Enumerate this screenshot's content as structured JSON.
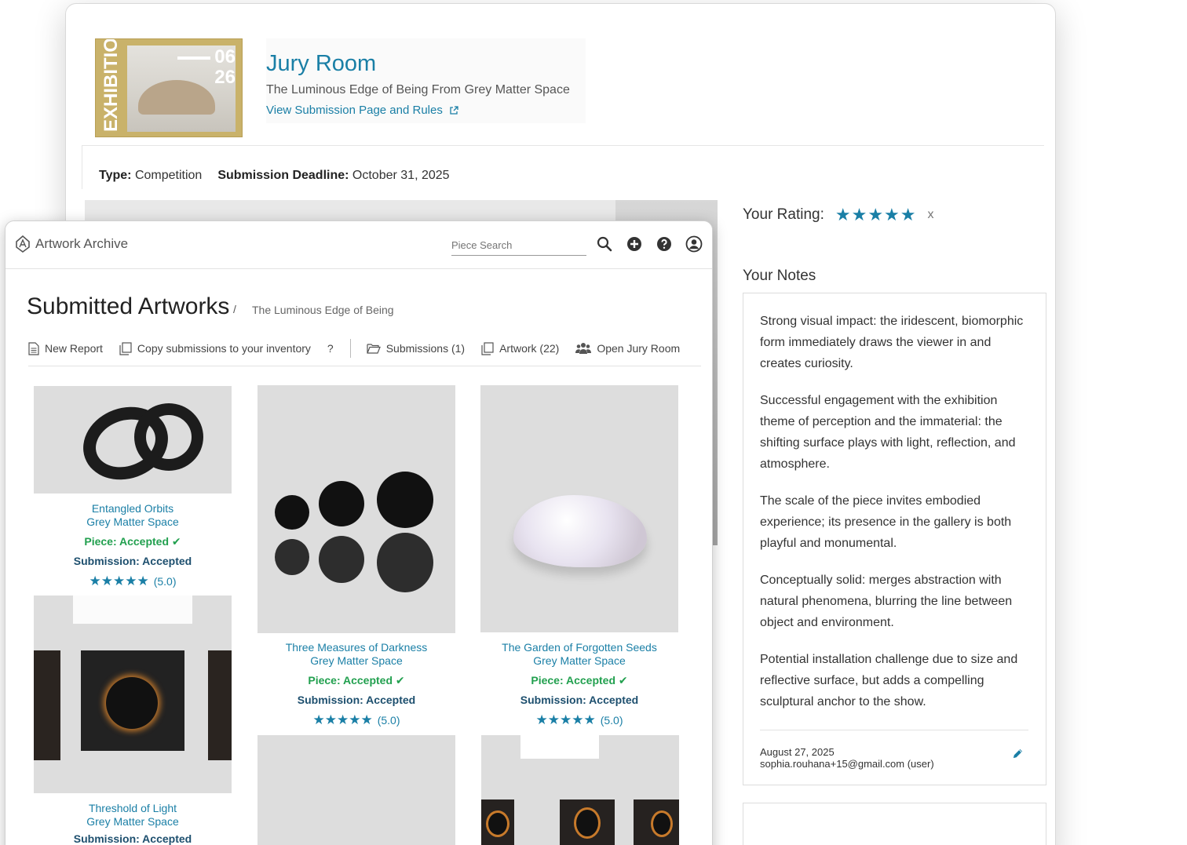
{
  "jury_room": {
    "title": "Jury Room",
    "subtitle": "The Luminous Edge of Being From Grey Matter Space",
    "link_label": "View Submission Page and Rules",
    "poster": {
      "vertical_text": "EXHIBITION",
      "date_line1": "06",
      "date_line2": "26"
    },
    "type_label": "Type:",
    "type_value": "Competition",
    "deadline_label": "Submission Deadline:",
    "deadline_value": "October 31, 2025",
    "rating_label": "Your Rating:",
    "rating_stars": "★★★★★",
    "rating_clear": "x",
    "notes_label": "Your Notes",
    "notes": [
      "Strong visual impact: the iridescent, biomorphic form immediately draws the viewer in and creates curiosity.",
      "Successful engagement with the exhibition theme of perception and the immaterial: the shifting surface plays with light, reflection, and atmosphere.",
      "The scale of the piece invites embodied experience; its presence in the gallery is both playful and monumental.",
      "Conceptually solid: merges abstraction with natural phenomena, blurring the line between object and environment.",
      "Potential installation challenge due to size and reflective surface, but adds a compelling sculptural anchor to the show."
    ],
    "note_date": "August 27, 2025",
    "note_user": "sophia.rouhana+15@gmail.com (user)"
  },
  "archive": {
    "brand": "Artwork Archive",
    "search_placeholder": "Piece Search",
    "icons": [
      "search-icon",
      "add-circle-icon",
      "help-icon",
      "user-icon"
    ],
    "page_title": "Submitted Artworks",
    "crumb_sep": "/",
    "breadcrumb": "The Luminous Edge of Being",
    "toolbar": {
      "new_report": "New Report",
      "copy": "Copy submissions to your inventory",
      "help": "?",
      "submissions": "Submissions (1)",
      "artwork": "Artwork (22)",
      "jury": "Open Jury Room"
    },
    "cards": [
      {
        "title": "Entangled Orbits",
        "artist": "Grey Matter Space",
        "piece": "Piece: Accepted",
        "submission": "Submission: Accepted",
        "stars": "★★★★★",
        "rating": "(5.0)"
      },
      {
        "title": "Three Measures of Darkness",
        "artist": "Grey Matter Space",
        "piece": "Piece: Accepted",
        "submission": "Submission: Accepted",
        "stars": "★★★★★",
        "rating": "(5.0)"
      },
      {
        "title": "The Garden of Forgotten Seeds",
        "artist": "Grey Matter Space",
        "piece": "Piece: Accepted",
        "submission": "Submission: Accepted",
        "stars": "★★★★★",
        "rating": "(5.0)"
      },
      {
        "title": "Threshold of Light",
        "artist": "Grey Matter Space",
        "submission": "Submission: Accepted"
      }
    ],
    "check_glyph": "✔"
  },
  "colors": {
    "accent": "#1a7fa6",
    "accepted_green": "#22a04f",
    "submission_navy": "#1d4f6e"
  }
}
